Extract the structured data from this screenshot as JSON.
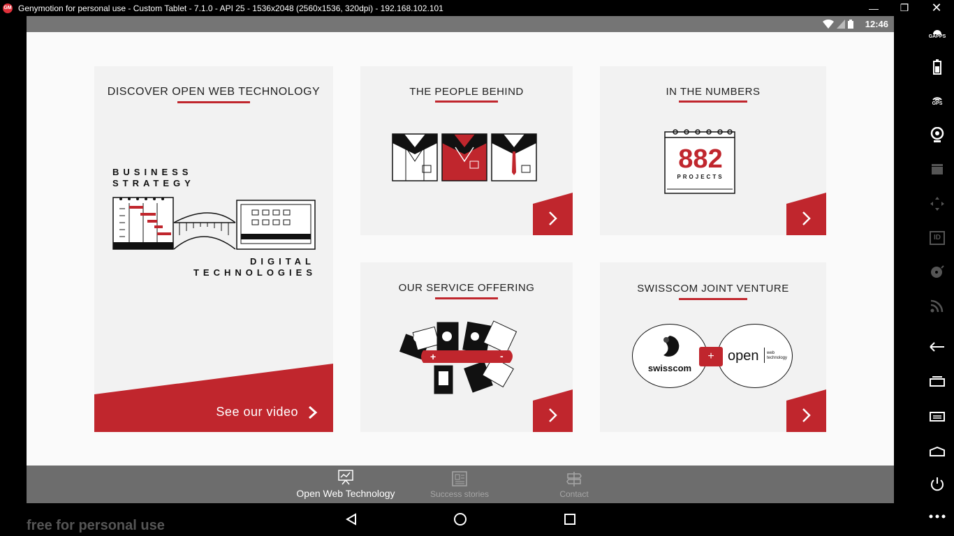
{
  "window": {
    "title": "Genymotion for personal use - Custom Tablet - 7.1.0 - API 25 - 1536x2048 (2560x1536, 320dpi) - 192.168.102.101",
    "logo_text": "GM"
  },
  "statusbar": {
    "time": "12:46"
  },
  "cards": {
    "discover": {
      "title": "DISCOVER OPEN WEB TECHNOLOGY",
      "line1": "BUSINESS",
      "line2": "STRATEGY",
      "line3": "DIGITAL",
      "line4": "TECHNOLOGIES",
      "cta": "See our video"
    },
    "people": {
      "title": "THE PEOPLE BEHIND"
    },
    "numbers": {
      "title": "IN THE NUMBERS",
      "count": "882",
      "unit": "PROJECTS"
    },
    "service": {
      "title": "OUR SERVICE OFFERING"
    },
    "joint": {
      "title": "SWISSCOM JOINT VENTURE",
      "left_logo": "swisscom",
      "right_logo": "open",
      "right_sub1": "web",
      "right_sub2": "technology"
    }
  },
  "bottom_nav": {
    "items": [
      {
        "label": "Open Web Technology",
        "active": true
      },
      {
        "label": "Success stories",
        "active": false
      },
      {
        "label": "Contact",
        "active": false
      }
    ]
  },
  "watermark": "free for personal use",
  "sidebar": {
    "gapps": "GAPPS",
    "gps": "GPS",
    "id": "ID"
  },
  "colors": {
    "accent": "#c0262d",
    "navbar": "#6d6d6d",
    "statusbar": "#757575"
  }
}
